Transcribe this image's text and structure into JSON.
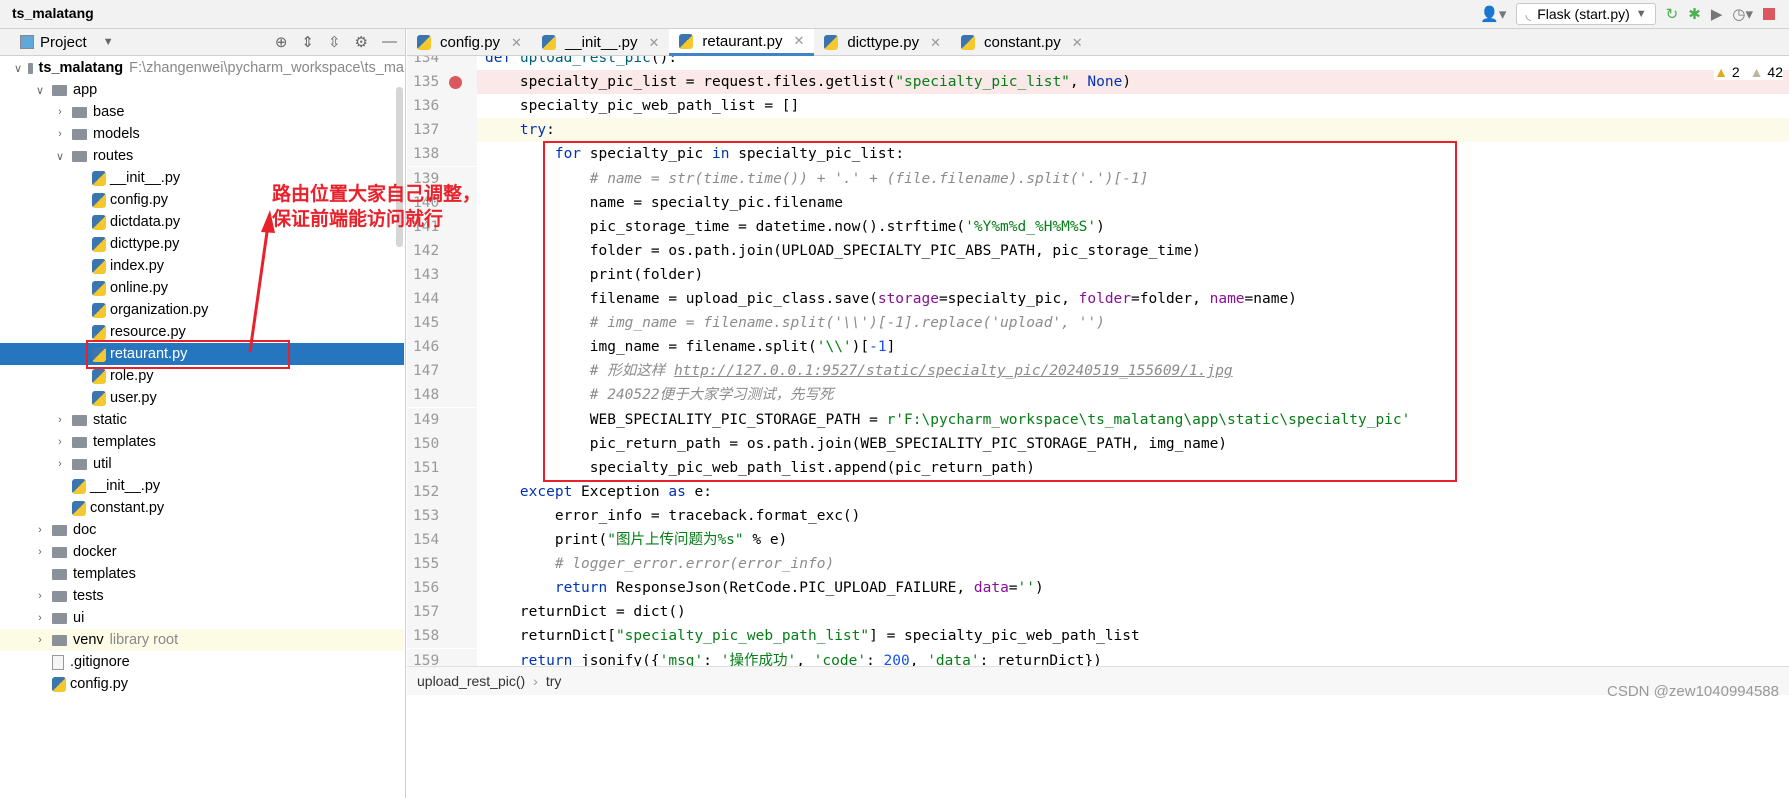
{
  "title_bar": {
    "project": "ts_malatang",
    "run_config": "Flask (start.py)"
  },
  "sidebar": {
    "title": "Project",
    "items": [
      {
        "label": "ts_malatang",
        "hint": "F:\\zhangenwei\\pycharm_workspace\\ts_ma",
        "type": "folder",
        "depth": 0,
        "expanded": true
      },
      {
        "label": "app",
        "type": "folder",
        "depth": 1,
        "expanded": true
      },
      {
        "label": "base",
        "type": "folder",
        "depth": 2,
        "expanded": false
      },
      {
        "label": "models",
        "type": "folder",
        "depth": 2,
        "expanded": false
      },
      {
        "label": "routes",
        "type": "folder",
        "depth": 2,
        "expanded": true
      },
      {
        "label": "__init__.py",
        "type": "py",
        "depth": 3
      },
      {
        "label": "config.py",
        "type": "py",
        "depth": 3
      },
      {
        "label": "dictdata.py",
        "type": "py",
        "depth": 3
      },
      {
        "label": "dicttype.py",
        "type": "py",
        "depth": 3
      },
      {
        "label": "index.py",
        "type": "py",
        "depth": 3
      },
      {
        "label": "online.py",
        "type": "py",
        "depth": 3
      },
      {
        "label": "organization.py",
        "type": "py",
        "depth": 3
      },
      {
        "label": "resource.py",
        "type": "py",
        "depth": 3
      },
      {
        "label": "retaurant.py",
        "type": "py",
        "depth": 3,
        "selected": true
      },
      {
        "label": "role.py",
        "type": "py",
        "depth": 3
      },
      {
        "label": "user.py",
        "type": "py",
        "depth": 3
      },
      {
        "label": "static",
        "type": "folder",
        "depth": 2,
        "expanded": false
      },
      {
        "label": "templates",
        "type": "folder",
        "depth": 2,
        "expanded": false
      },
      {
        "label": "util",
        "type": "folder",
        "depth": 2,
        "expanded": false
      },
      {
        "label": "__init__.py",
        "type": "py",
        "depth": 2
      },
      {
        "label": "constant.py",
        "type": "py",
        "depth": 2
      },
      {
        "label": "doc",
        "type": "folder",
        "depth": 1,
        "expanded": false
      },
      {
        "label": "docker",
        "type": "folder",
        "depth": 1,
        "expanded": false
      },
      {
        "label": "templates",
        "type": "folder",
        "depth": 1,
        "leaf": true
      },
      {
        "label": "tests",
        "type": "folder",
        "depth": 1,
        "expanded": false
      },
      {
        "label": "ui",
        "type": "folder",
        "depth": 1,
        "expanded": false
      },
      {
        "label": "venv",
        "hint": "library root",
        "type": "folder",
        "depth": 1,
        "expanded": false,
        "venv": true
      },
      {
        "label": ".gitignore",
        "type": "file",
        "depth": 1
      },
      {
        "label": "config.py",
        "type": "py",
        "depth": 1
      }
    ]
  },
  "tabs": [
    {
      "label": "config.py"
    },
    {
      "label": "__init__.py"
    },
    {
      "label": "retaurant.py",
      "active": true
    },
    {
      "label": "dicttype.py"
    },
    {
      "label": "constant.py"
    }
  ],
  "warnings": {
    "errors": "2",
    "weak": "42"
  },
  "annotation": {
    "line1": "路由位置大家自己调整，",
    "line2": "保证前端能访问就行"
  },
  "breadcrumb": [
    "upload_rest_pic()",
    "try"
  ],
  "watermark": "CSDN @zew1040994588",
  "code": [
    {
      "n": "134",
      "t": [
        [
          "kw",
          "def "
        ],
        [
          "fn",
          "upload_rest_pic"
        ],
        [
          "",
          "():"
        ]
      ]
    },
    {
      "n": "135",
      "bp": true,
      "t": [
        [
          "",
          "    specialty_pic_list = request.files.getlist("
        ],
        [
          "str",
          "\"specialty_pic_list\""
        ],
        [
          "",
          ", "
        ],
        [
          "kw",
          "None"
        ],
        [
          "",
          ")"
        ]
      ]
    },
    {
      "n": "136",
      "t": [
        [
          "",
          "    specialty_pic_web_path_list = []"
        ]
      ]
    },
    {
      "n": "137",
      "cur": true,
      "t": [
        [
          "kw",
          "    try"
        ],
        [
          "",
          ":"
        ]
      ]
    },
    {
      "n": "138",
      "t": [
        [
          "kw",
          "        for "
        ],
        [
          "",
          "specialty_pic "
        ],
        [
          "kw",
          "in "
        ],
        [
          "",
          "specialty_pic_list:"
        ]
      ]
    },
    {
      "n": "139",
      "t": [
        [
          "cm",
          "            # name = str(time.time()) + '.' + (file.filename).split('.')[-1]"
        ]
      ]
    },
    {
      "n": "140",
      "t": [
        [
          "",
          "            name = specialty_pic.filename"
        ]
      ]
    },
    {
      "n": "141",
      "t": [
        [
          "",
          "            pic_storage_time = datetime.now().strftime("
        ],
        [
          "str",
          "'%Y%m%d_%H%M%S'"
        ],
        [
          "",
          ")"
        ]
      ]
    },
    {
      "n": "142",
      "t": [
        [
          "",
          "            folder = os.path.join(UPLOAD_SPECIALTY_PIC_ABS_PATH, pic_storage_time)"
        ]
      ]
    },
    {
      "n": "143",
      "t": [
        [
          "",
          "            print(folder)"
        ]
      ]
    },
    {
      "n": "144",
      "t": [
        [
          "",
          "            filename = upload_pic_class.save("
        ],
        [
          "param",
          "storage"
        ],
        [
          "",
          "=specialty_pic, "
        ],
        [
          "param",
          "folder"
        ],
        [
          "",
          "=folder, "
        ],
        [
          "param",
          "name"
        ],
        [
          "",
          "=name)"
        ]
      ]
    },
    {
      "n": "145",
      "t": [
        [
          "cm",
          "            # img_name = filename.split('\\\\')[-1].replace('upload', '')"
        ]
      ]
    },
    {
      "n": "146",
      "t": [
        [
          "",
          "            img_name = filename.split("
        ],
        [
          "str",
          "'\\\\'"
        ],
        [
          "",
          ")["
        ],
        [
          "num",
          "-1"
        ],
        [
          "",
          "]"
        ]
      ]
    },
    {
      "n": "147",
      "t": [
        [
          "cm",
          "            # 形如这样 "
        ],
        [
          "link",
          "http://127.0.0.1:9527/static/specialty_pic/20240519_155609/1.jpg"
        ]
      ]
    },
    {
      "n": "148",
      "t": [
        [
          "cm",
          "            # 240522便于大家学习测试，先写死"
        ]
      ]
    },
    {
      "n": "149",
      "t": [
        [
          "",
          "            WEB_SPECIALITY_PIC_STORAGE_PATH = "
        ],
        [
          "str",
          "r'F:\\pycharm_workspace\\ts_malatang\\app\\static\\specialty_pic'"
        ]
      ]
    },
    {
      "n": "150",
      "t": [
        [
          "",
          "            pic_return_path = os.path.join(WEB_SPECIALITY_PIC_STORAGE_PATH, img_name)"
        ]
      ]
    },
    {
      "n": "151",
      "t": [
        [
          "",
          "            specialty_pic_web_path_list.append(pic_return_path)"
        ]
      ]
    },
    {
      "n": "152",
      "t": [
        [
          "kw",
          "    except "
        ],
        [
          "",
          "Exception "
        ],
        [
          "kw",
          "as "
        ],
        [
          "",
          "e:"
        ]
      ]
    },
    {
      "n": "153",
      "t": [
        [
          "",
          "        error_info = traceback.format_exc()"
        ]
      ]
    },
    {
      "n": "154",
      "t": [
        [
          "",
          "        print("
        ],
        [
          "str",
          "\"图片上传问题为%s\""
        ],
        [
          "",
          " % e)"
        ]
      ]
    },
    {
      "n": "155",
      "t": [
        [
          "cm",
          "        # logger_error.error(error_info)"
        ]
      ]
    },
    {
      "n": "156",
      "t": [
        [
          "kw",
          "        return "
        ],
        [
          "",
          "ResponseJson(RetCode.PIC_UPLOAD_FAILURE, "
        ],
        [
          "param",
          "data"
        ],
        [
          "",
          "="
        ],
        [
          "str",
          "''"
        ],
        [
          "",
          ")"
        ]
      ]
    },
    {
      "n": "157",
      "t": [
        [
          "",
          "    returnDict = dict()"
        ]
      ]
    },
    {
      "n": "158",
      "t": [
        [
          "",
          "    returnDict["
        ],
        [
          "str",
          "\"specialty_pic_web_path_list\""
        ],
        [
          "",
          "] = specialty_pic_web_path_list"
        ]
      ]
    },
    {
      "n": "159",
      "t": [
        [
          "kw",
          "    return "
        ],
        [
          "",
          "jsonify({"
        ],
        [
          "str",
          "'msg'"
        ],
        [
          "",
          ": "
        ],
        [
          "str",
          "'操作成功'"
        ],
        [
          "",
          ", "
        ],
        [
          "str",
          "'code'"
        ],
        [
          "",
          ": "
        ],
        [
          "num",
          "200"
        ],
        [
          "",
          ", "
        ],
        [
          "str",
          "'data'"
        ],
        [
          "",
          ": returnDict})"
        ]
      ]
    }
  ]
}
